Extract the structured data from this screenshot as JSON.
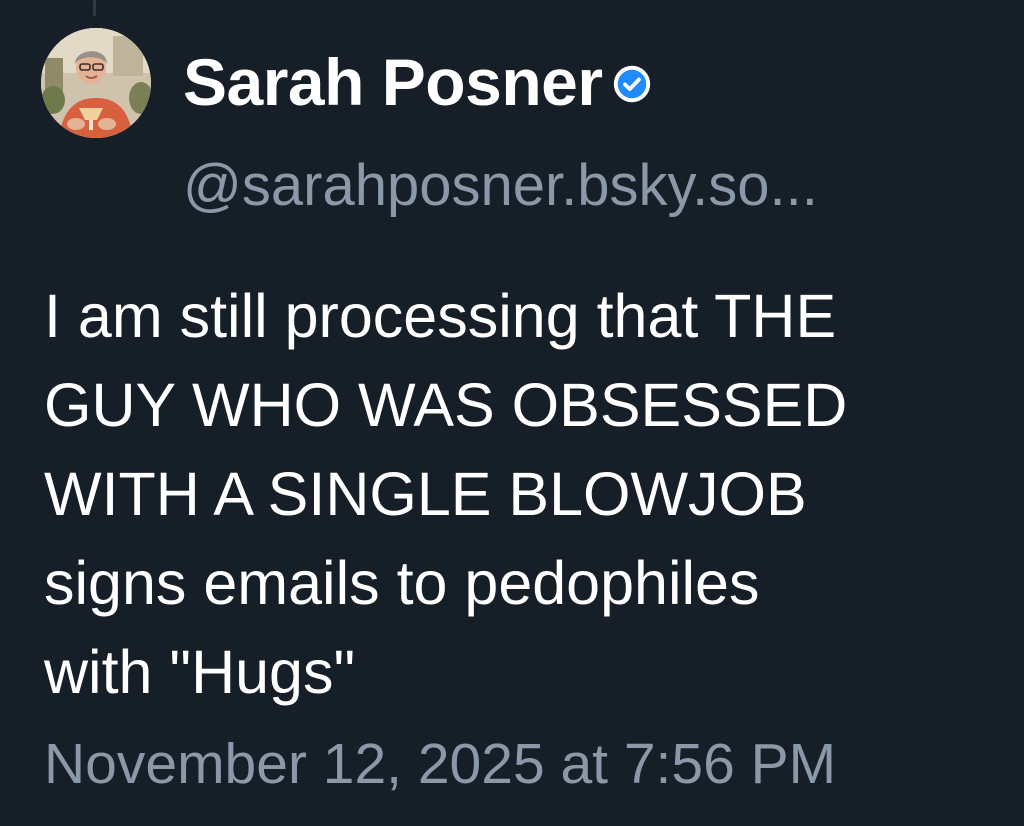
{
  "post": {
    "author": {
      "display_name": "Sarah Posner",
      "handle": "@sarahposner.bsky.so...",
      "verified": true,
      "avatar": "profile-photo"
    },
    "text": "I am still processing that THE\nGUY WHO WAS OBSESSED\nWITH A SINGLE BLOWJOB\nsigns emails to pedophiles\nwith \"Hugs\"",
    "timestamp": "November 12, 2025 at 7:56 PM"
  },
  "colors": {
    "background": "#161e27",
    "text": "#ffffff",
    "muted": "#8b98a8",
    "verified_badge": "#208bfe"
  },
  "icons": {
    "verified": "verified-check-icon"
  }
}
